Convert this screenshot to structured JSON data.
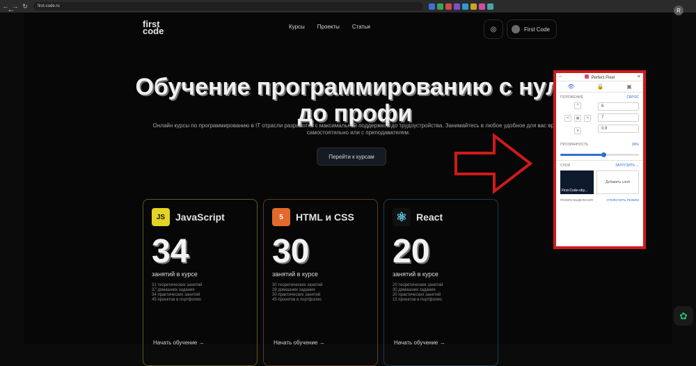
{
  "browser": {
    "url": "first-code.ru",
    "avatar_letter": "R"
  },
  "site": {
    "logo_line1": "first",
    "logo_line2": "code",
    "nav": [
      "Курсы",
      "Проекты",
      "Статьи"
    ],
    "user_name": "First Code"
  },
  "hero": {
    "title": "Обучение программированию с нуля до профи",
    "subtitle": "Онлайн курсы по программированию в IT отрасли разработки с максимальной поддержкой до трудоустройства. Занимайтесь в любое удобное для вас время самостоятельно или с преподавателем.",
    "cta": "Перейти к курсам"
  },
  "courses": [
    {
      "name": "JavaScript",
      "icon": "JS",
      "count": "34",
      "label": "занятий в курсе",
      "items": [
        "31 теоретических занятий",
        "37 домашних задания",
        "34 практических занятий",
        "45 проектов в портфолио"
      ],
      "link": "Начать обучение",
      "accent": "#e4d323"
    },
    {
      "name": "HTML и CSS",
      "icon": "5",
      "count": "30",
      "label": "занятий в курсе",
      "items": [
        "30 теоретических занятий",
        "29 домашних задания",
        "30 практических занятий",
        "45 проектов в портфолио"
      ],
      "link": "Начать обучение",
      "accent": "#e36a2c"
    },
    {
      "name": "React",
      "icon": "⚛",
      "count": "20",
      "label": "занятий в курсе",
      "items": [
        "20 теоретических занятий",
        "30 домашних задания",
        "20 практических занятий",
        "15 проектов в портфолио"
      ],
      "link": "Начать обучение",
      "accent": "#5ecbe6"
    }
  ],
  "perfect_pixel": {
    "title": "Perfect Pixel",
    "position_label": "ПОЛОЖЕНИЕ",
    "reset_label": "СБРОС",
    "x_value": "6",
    "y_value": "7",
    "scale_value": "0.9",
    "opacity_label": "ПРОЗРАЧНОСТЬ",
    "opacity_value": "99%",
    "opacity_fraction": 0.55,
    "layers_label": "СЛОИ",
    "upload_label": "ЗАГРУЗИТЬ",
    "layer_name": "First-Code-oby...",
    "add_layer": "Добавить слой",
    "bottom_left": "РЕЖИМ ВЫДЕЛЕНИЯ",
    "bottom_right": "ОТКЛЮЧИТЬ РЕЖИМ"
  }
}
